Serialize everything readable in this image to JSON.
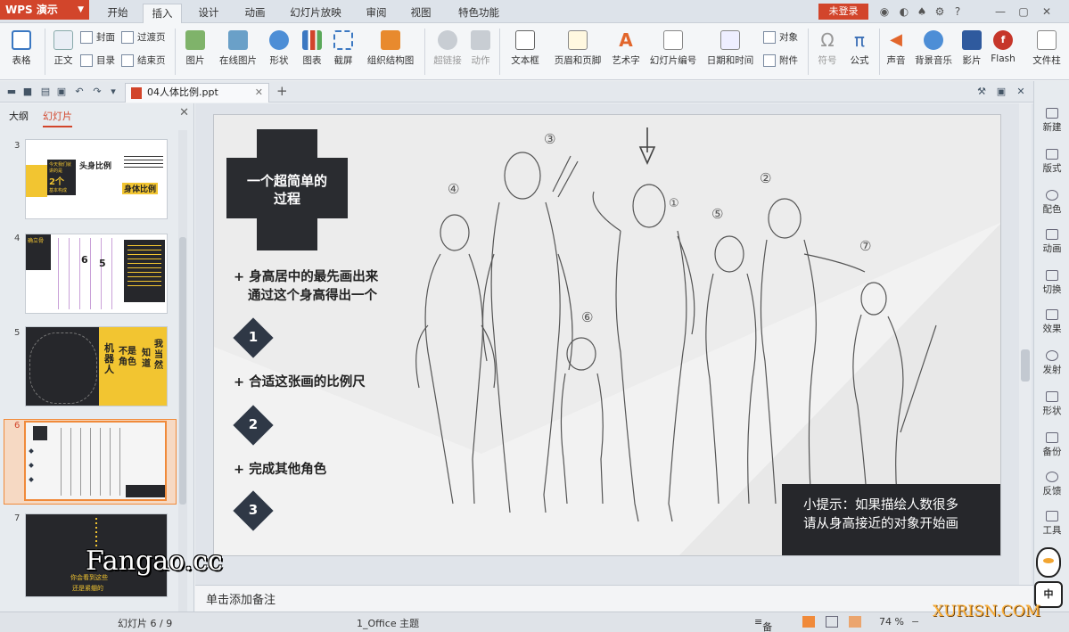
{
  "app": {
    "brand": "WPS 演示",
    "menu_tabs": [
      "开始",
      "插入",
      "设计",
      "动画",
      "幻灯片放映",
      "审阅",
      "视图",
      "特色功能"
    ],
    "active_tab": "插入",
    "login": "未登录"
  },
  "ribbon": {
    "table": "表格",
    "text_body": "正文",
    "cover": "封面",
    "contents": "目录",
    "transition": "过渡页",
    "ending": "结束页",
    "picture": "图片",
    "online_picture": "在线图片",
    "shape": "形状",
    "chart": "图表",
    "screenshot": "截屏",
    "org_chart": "组织结构图",
    "hyperlink": "超链接",
    "action": "动作",
    "textbox": "文本框",
    "header_footer": "页眉和页脚",
    "wordart": "艺术字",
    "slide_number": "幻灯片编号",
    "date_time": "日期和时间",
    "object": "对象",
    "attachment": "附件",
    "symbol": "符号",
    "formula": "公式",
    "sound": "声音",
    "bg_music": "背景音乐",
    "movie": "影片",
    "flash": "Flash",
    "file": "文件柱"
  },
  "doc": {
    "filename": "04人体比例.ppt"
  },
  "left_panel": {
    "tab_outline": "大纲",
    "tab_slides": "幻灯片",
    "thumbs": [
      {
        "num": "3",
        "t1": "头身比例",
        "t2": "身体比例",
        "t3": "今天我们就讲的是",
        "t4": "2个",
        "t5": "基本构成"
      },
      {
        "num": "4",
        "t1": "6",
        "t2": "5",
        "t3": "确立骨"
      },
      {
        "num": "5",
        "t1": "机器人",
        "t2": "不是角色",
        "t3": "知道",
        "t4": "我当然"
      },
      {
        "num": "6"
      },
      {
        "num": "7",
        "t1": "你会看到这些",
        "t2": "还是紧绷的"
      }
    ]
  },
  "slide": {
    "title_line1": "一个超简单的",
    "title_line2": "过程",
    "bullet1_line1": "+ 身高居中的最先画出来",
    "bullet1_line2": "通过这个身高得出一个",
    "step1": "1",
    "bullet2": "+ 合适这张画的比例尺",
    "step2": "2",
    "bullet3": "+ 完成其他角色",
    "step3": "3",
    "tip_line1": "小提示：如果描绘人数很多",
    "tip_line2": "请从身高接近的对象开始画",
    "sketch_labels": [
      "③",
      "④",
      "①",
      "②",
      "⑤",
      "⑥",
      "⑦"
    ]
  },
  "notes": "单击添加备注",
  "right_bar": [
    "新建",
    "版式",
    "配色",
    "动画",
    "切换",
    "效果",
    "发射",
    "形状",
    "备份",
    "反馈",
    "工具"
  ],
  "status": {
    "slide_info": "幻灯片 6 / 9",
    "theme": "1_Office 主题",
    "notes_btn": "备注",
    "zoom": "74 %"
  },
  "watermarks": {
    "fangao": "Fangao.cc",
    "xurisn": "XURISN.COM",
    "ime": "中"
  },
  "colors": {
    "accent_red": "#d2452b",
    "dark_block": "#2a2c30",
    "diamond": "#2f3846",
    "yellow": "#f2c531"
  }
}
